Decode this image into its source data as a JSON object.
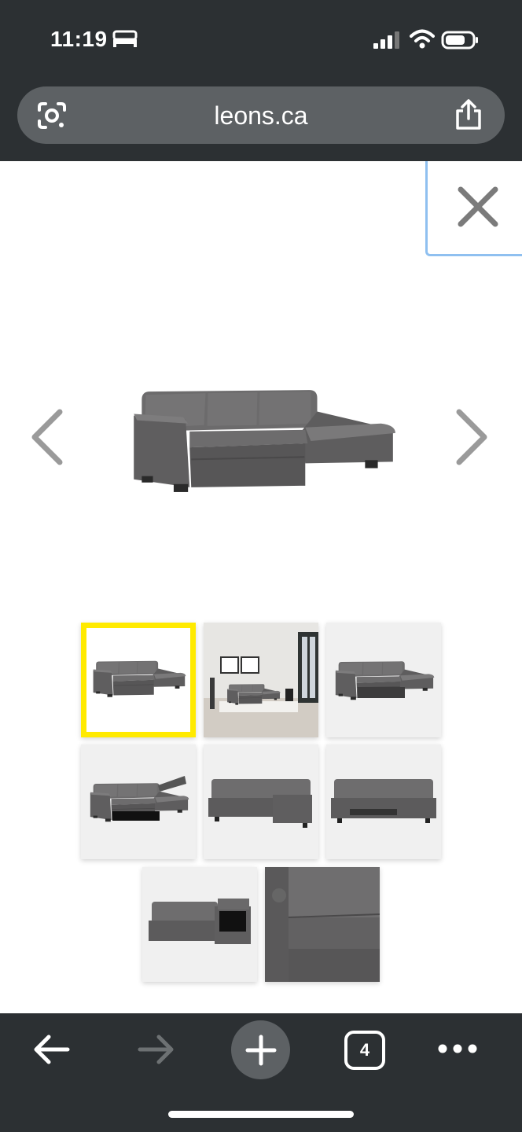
{
  "status_bar": {
    "time": "11:19",
    "icons": [
      "bed-icon",
      "signal-icon",
      "wifi-icon",
      "battery-icon"
    ]
  },
  "browser": {
    "url": "leons.ca",
    "tab_count": "4"
  },
  "gallery": {
    "selected_index": 0,
    "thumbnails": [
      "sofa-thumbnail",
      "room-thumbnail",
      "sofa-bed-thumbnail",
      "storage-thumbnail",
      "front-thumbnail",
      "sleeper-thumbnail",
      "ottoman-storage-thumbnail",
      "fabric-detail-thumbnail"
    ]
  },
  "colors": {
    "chrome": "#2c3033",
    "selection": "#ffea00",
    "close_border": "#8fc0f0"
  }
}
